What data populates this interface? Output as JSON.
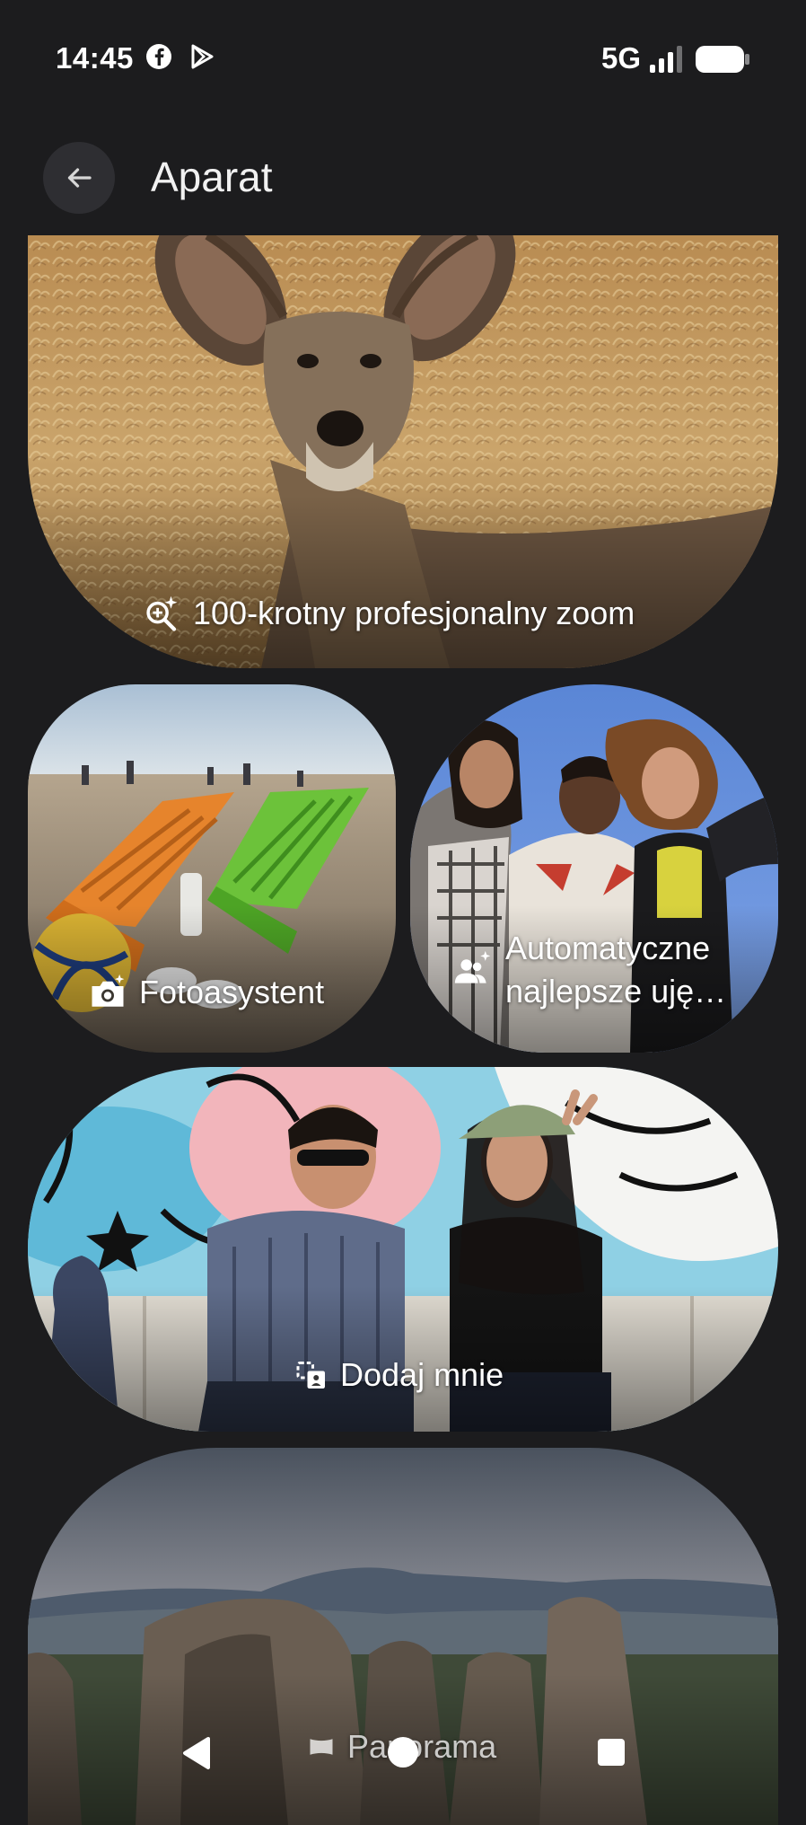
{
  "status_bar": {
    "time": "14:45",
    "network": "5G",
    "icons": [
      "facebook-icon",
      "play-store-icon",
      "signal-icon",
      "battery-icon"
    ]
  },
  "header": {
    "title": "Aparat",
    "back_icon": "arrow-left-icon"
  },
  "cards": {
    "zoom": {
      "label": "100-krotny profesjonalny zoom",
      "icon": "zoom-sparkle-icon"
    },
    "assistant": {
      "label": "Fotoasystent",
      "icon": "camera-sparkle-icon"
    },
    "best_shot": {
      "label_line1": "Automatyczne",
      "label_line2": "najlepsze uję…",
      "icon": "people-sparkle-icon"
    },
    "add_me": {
      "label": "Dodaj mnie",
      "icon": "add-me-icon"
    },
    "panorama": {
      "label": "Panorama",
      "icon": "panorama-icon"
    }
  },
  "nav_bar": {
    "icons": [
      "back-triangle-icon",
      "home-circle-icon",
      "recents-square-icon"
    ]
  },
  "colors": {
    "background": "#1c1c1e",
    "text": "#ffffff"
  }
}
